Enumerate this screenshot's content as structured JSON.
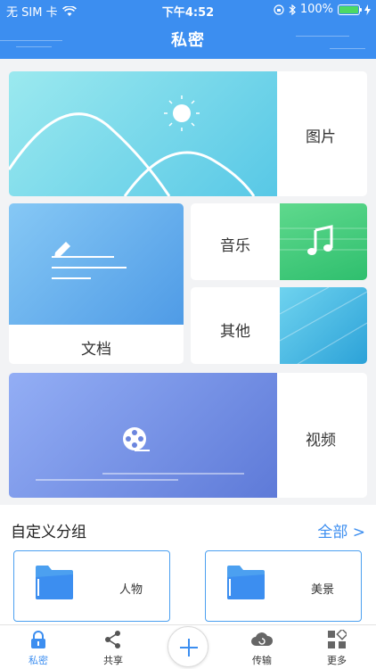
{
  "status_bar": {
    "carrier": "无 SIM 卡",
    "time": "下午4:52",
    "battery": "100%",
    "battery_level": 1.0,
    "wifi_icon": "wifi-icon",
    "bluetooth_icon": "bluetooth-icon"
  },
  "nav": {
    "title": "私密"
  },
  "categories": {
    "photos": "图片",
    "documents": "文档",
    "music": "音乐",
    "other": "其他",
    "video": "视频"
  },
  "custom_group": {
    "title": "自定义分组",
    "all_link": "全部 >",
    "folders": [
      {
        "name": "人物",
        "icon": "folder-icon"
      },
      {
        "name": "美景",
        "icon": "folder-icon"
      }
    ]
  },
  "tabbar": {
    "items": [
      {
        "label": "私密",
        "icon": "lock-icon",
        "active": true
      },
      {
        "label": "共享",
        "icon": "share-icon",
        "active": false
      },
      {
        "label": "传输",
        "icon": "cloud-sync-icon",
        "active": false
      },
      {
        "label": "更多",
        "icon": "grid-more-icon",
        "active": false
      }
    ],
    "center_button_icon": "plus-icon"
  },
  "colors": {
    "primary": "#3c8ef0",
    "music": "#2fbf6e",
    "video": "#5e7ad8"
  }
}
